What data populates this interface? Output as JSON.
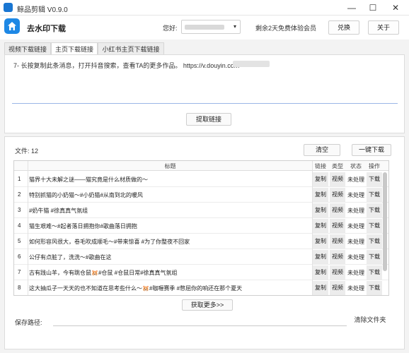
{
  "window": {
    "title": "鲸品剪辑 V0.9.0",
    "minimize": "—",
    "maximize": "☐",
    "close": "✕"
  },
  "header": {
    "app_title": "去水印下载",
    "greeting": "您好:",
    "user_caret": "▾",
    "member_text": "剩余2天免费体验会员",
    "redeem": "兑换",
    "about": "关于"
  },
  "tabs": [
    "视频下载链接",
    "主页下载链接",
    "小红书主页下载链接"
  ],
  "input": {
    "text": "7- 长按复制此条消息，打开抖音搜索，查看TA的更多作品。 https://v.douyin.com"
  },
  "extract_button": "提取链接",
  "files": {
    "label": "文件: 12",
    "clear": "清空",
    "download_all": "一键下载"
  },
  "table": {
    "headers": {
      "title": "标题",
      "link": "链接",
      "type": "类型",
      "status": "状态",
      "action": "操作"
    },
    "rows": [
      {
        "num": "1",
        "title": "猫界十大未解之谜——猫究竟是什么材质做的～",
        "copy": "复制",
        "type": "视频",
        "status": "未处理",
        "action": "下载"
      },
      {
        "num": "2",
        "title": "特别抓猫的小奶猫～#小奶猫#从南到北的暖风",
        "copy": "复制",
        "type": "视频",
        "status": "未处理",
        "action": "下载"
      },
      {
        "num": "3",
        "title": "#奶牛猫 #徐真真气氛组",
        "copy": "复制",
        "type": "视频",
        "status": "未处理",
        "action": "下载"
      },
      {
        "num": "4",
        "title": "猫生艰难～#起者落日拥抱你#歌曲落日拥抱",
        "copy": "复制",
        "type": "视频",
        "status": "未处理",
        "action": "下载"
      },
      {
        "num": "5",
        "title": "如何形容风很大，卷毛吹成顺毛～#带来惊喜 #为了你整夜不回家",
        "copy": "复制",
        "type": "视频",
        "status": "未处理",
        "action": "下载"
      },
      {
        "num": "6",
        "title": "公仔有点脏了，洗洗～#歌曲在这",
        "copy": "复制",
        "type": "视频",
        "status": "未处理",
        "action": "下载"
      },
      {
        "num": "7",
        "title": "古有践山羊，今有跳仓鼠🐹#仓鼠 #仓鼠日常#徐真真气氛组",
        "copy": "复制",
        "type": "视频",
        "status": "未处理",
        "action": "下载"
      },
      {
        "num": "8",
        "title": "这大抽瓜子一天天的也不知道在思考些什么～🐹#咖喱赛季 #憋屈你的响还在那个夏天",
        "copy": "复制",
        "type": "视频",
        "status": "未处理",
        "action": "下载"
      }
    ]
  },
  "more_button": "获取更多>>",
  "save": {
    "label": "保存路径:",
    "value": "",
    "clear_file": "清除文件夹"
  }
}
